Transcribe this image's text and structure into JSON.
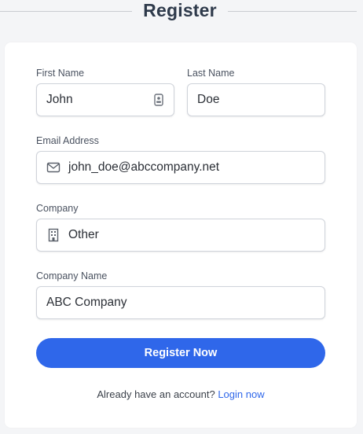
{
  "page": {
    "title": "Register"
  },
  "form": {
    "first_name": {
      "label": "First Name",
      "value": "John",
      "icon": "contact-card-icon"
    },
    "last_name": {
      "label": "Last Name",
      "value": "Doe"
    },
    "email": {
      "label": "Email Address",
      "value": "john_doe@abccompany.net",
      "icon": "mail-icon"
    },
    "company": {
      "label": "Company",
      "value": "Other",
      "icon": "building-icon"
    },
    "company_name": {
      "label": "Company Name",
      "value": "ABC Company"
    },
    "submit_label": "Register Now"
  },
  "footer": {
    "text": "Already have an account?",
    "link_label": "Login now"
  },
  "colors": {
    "accent": "#2f67ea",
    "page_background": "#f4f5f7",
    "card_background": "#ffffff"
  }
}
